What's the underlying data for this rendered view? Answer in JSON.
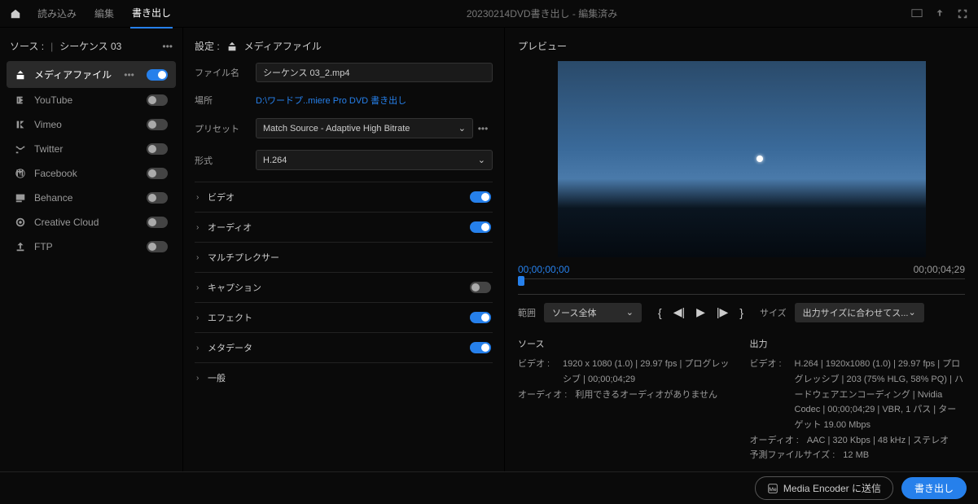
{
  "topbar": {
    "tabs": [
      "読み込み",
      "編集",
      "書き出し"
    ],
    "title": "20230214DVD書き出し - 編集済み"
  },
  "sidebar": {
    "source_label": "ソース :",
    "source_value": "シーケンス 03",
    "destinations": [
      {
        "label": "メディアファイル",
        "on": true,
        "active": true
      },
      {
        "label": "YouTube",
        "on": false
      },
      {
        "label": "Vimeo",
        "on": false
      },
      {
        "label": "Twitter",
        "on": false
      },
      {
        "label": "Facebook",
        "on": false
      },
      {
        "label": "Behance",
        "on": false
      },
      {
        "label": "Creative Cloud",
        "on": false
      },
      {
        "label": "FTP",
        "on": false
      }
    ]
  },
  "settings": {
    "head_label": "設定 :",
    "head_value": "メディアファイル",
    "filename_label": "ファイル名",
    "filename_value": "シーケンス 03_2.mp4",
    "location_label": "場所",
    "location_value": "D:\\ワードプ..miere Pro DVD 書き出し",
    "preset_label": "プリセット",
    "preset_value": "Match Source - Adaptive High Bitrate",
    "format_label": "形式",
    "format_value": "H.264",
    "sections": [
      {
        "name": "ビデオ",
        "on": true
      },
      {
        "name": "オーディオ",
        "on": true
      },
      {
        "name": "マルチプレクサー",
        "on": null
      },
      {
        "name": "キャプション",
        "on": false
      },
      {
        "name": "エフェクト",
        "on": true
      },
      {
        "name": "メタデータ",
        "on": true
      },
      {
        "name": "一般",
        "on": null
      }
    ]
  },
  "preview": {
    "title": "プレビュー",
    "time_start": "00;00;00;00",
    "time_end": "00;00;04;29",
    "range_label": "範囲",
    "range_value": "ソース全体",
    "size_label": "サイズ",
    "size_value": "出力サイズに合わせてス...",
    "info": {
      "source_head": "ソース",
      "source_video_k": "ビデオ :",
      "source_video_v": "1920 x 1080 (1.0) | 29.97 fps | プログレッシブ | 00;00;04;29",
      "source_audio_k": "オーディオ :",
      "source_audio_v": "利用できるオーディオがありません",
      "output_head": "出力",
      "output_video_k": "ビデオ :",
      "output_video_v": "H.264 | 1920x1080 (1.0) | 29.97 fps | プログレッシブ | 203 (75% HLG, 58% PQ) | ハードウェアエンコーディング | Nvidia Codec | 00;00;04;29 | VBR, 1 パス | ターゲット 19.00 Mbps",
      "output_audio_k": "オーディオ :",
      "output_audio_v": "AAC | 320 Kbps | 48 kHz | ステレオ",
      "filesize_k": "予測ファイルサイズ :",
      "filesize_v": "12 MB"
    }
  },
  "bottombar": {
    "encoder_btn": "Media Encoder に送信",
    "export_btn": "書き出し"
  }
}
